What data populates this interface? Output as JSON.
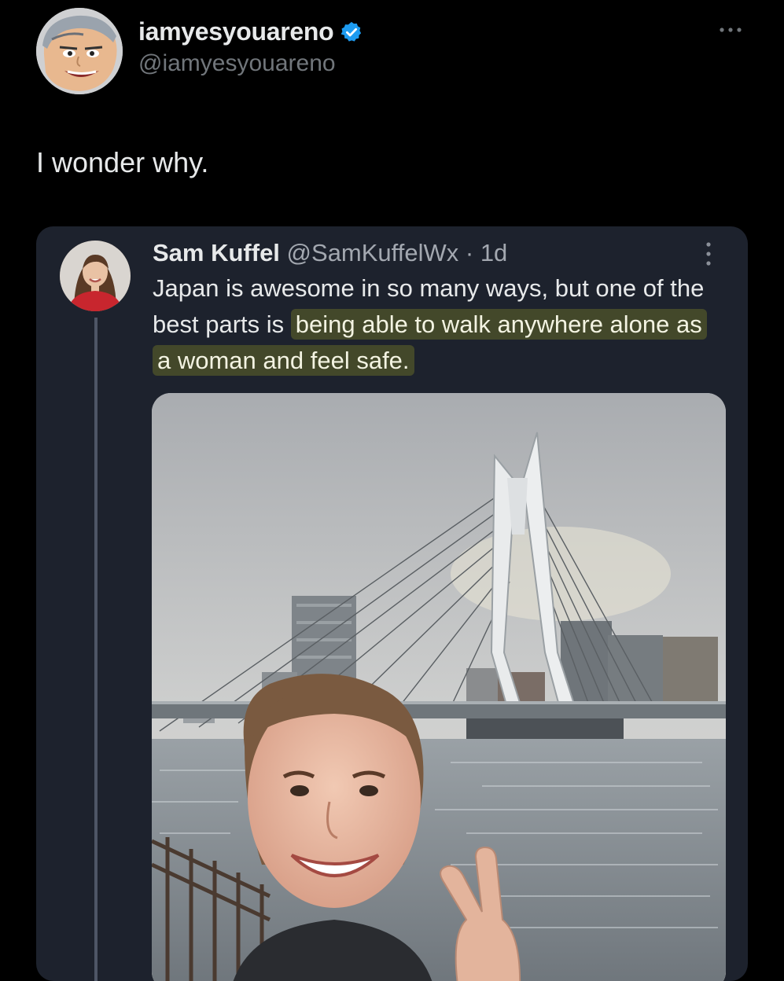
{
  "tweet": {
    "display_name": "iamyesyouareno",
    "handle": "@iamyesyouareno",
    "verified": true,
    "text": "I wonder why."
  },
  "quoted_tweet": {
    "display_name": "Sam Kuffel",
    "handle": "@SamKuffelWx",
    "separator": "·",
    "time": "1d",
    "text_plain": "Japan is awesome in so many ways, but one of the best parts is ",
    "text_highlighted": "being able to walk anywhere alone as a woman and feel safe."
  },
  "icons": {
    "more": "more-horizontal-icon",
    "quoted_more": "more-vertical-icon",
    "verified": "verified-badge-icon"
  },
  "colors": {
    "background": "#000000",
    "card": "#1d222d",
    "verified": "#1d9bf0",
    "handle": "#71767b",
    "highlight": "#43482a"
  }
}
